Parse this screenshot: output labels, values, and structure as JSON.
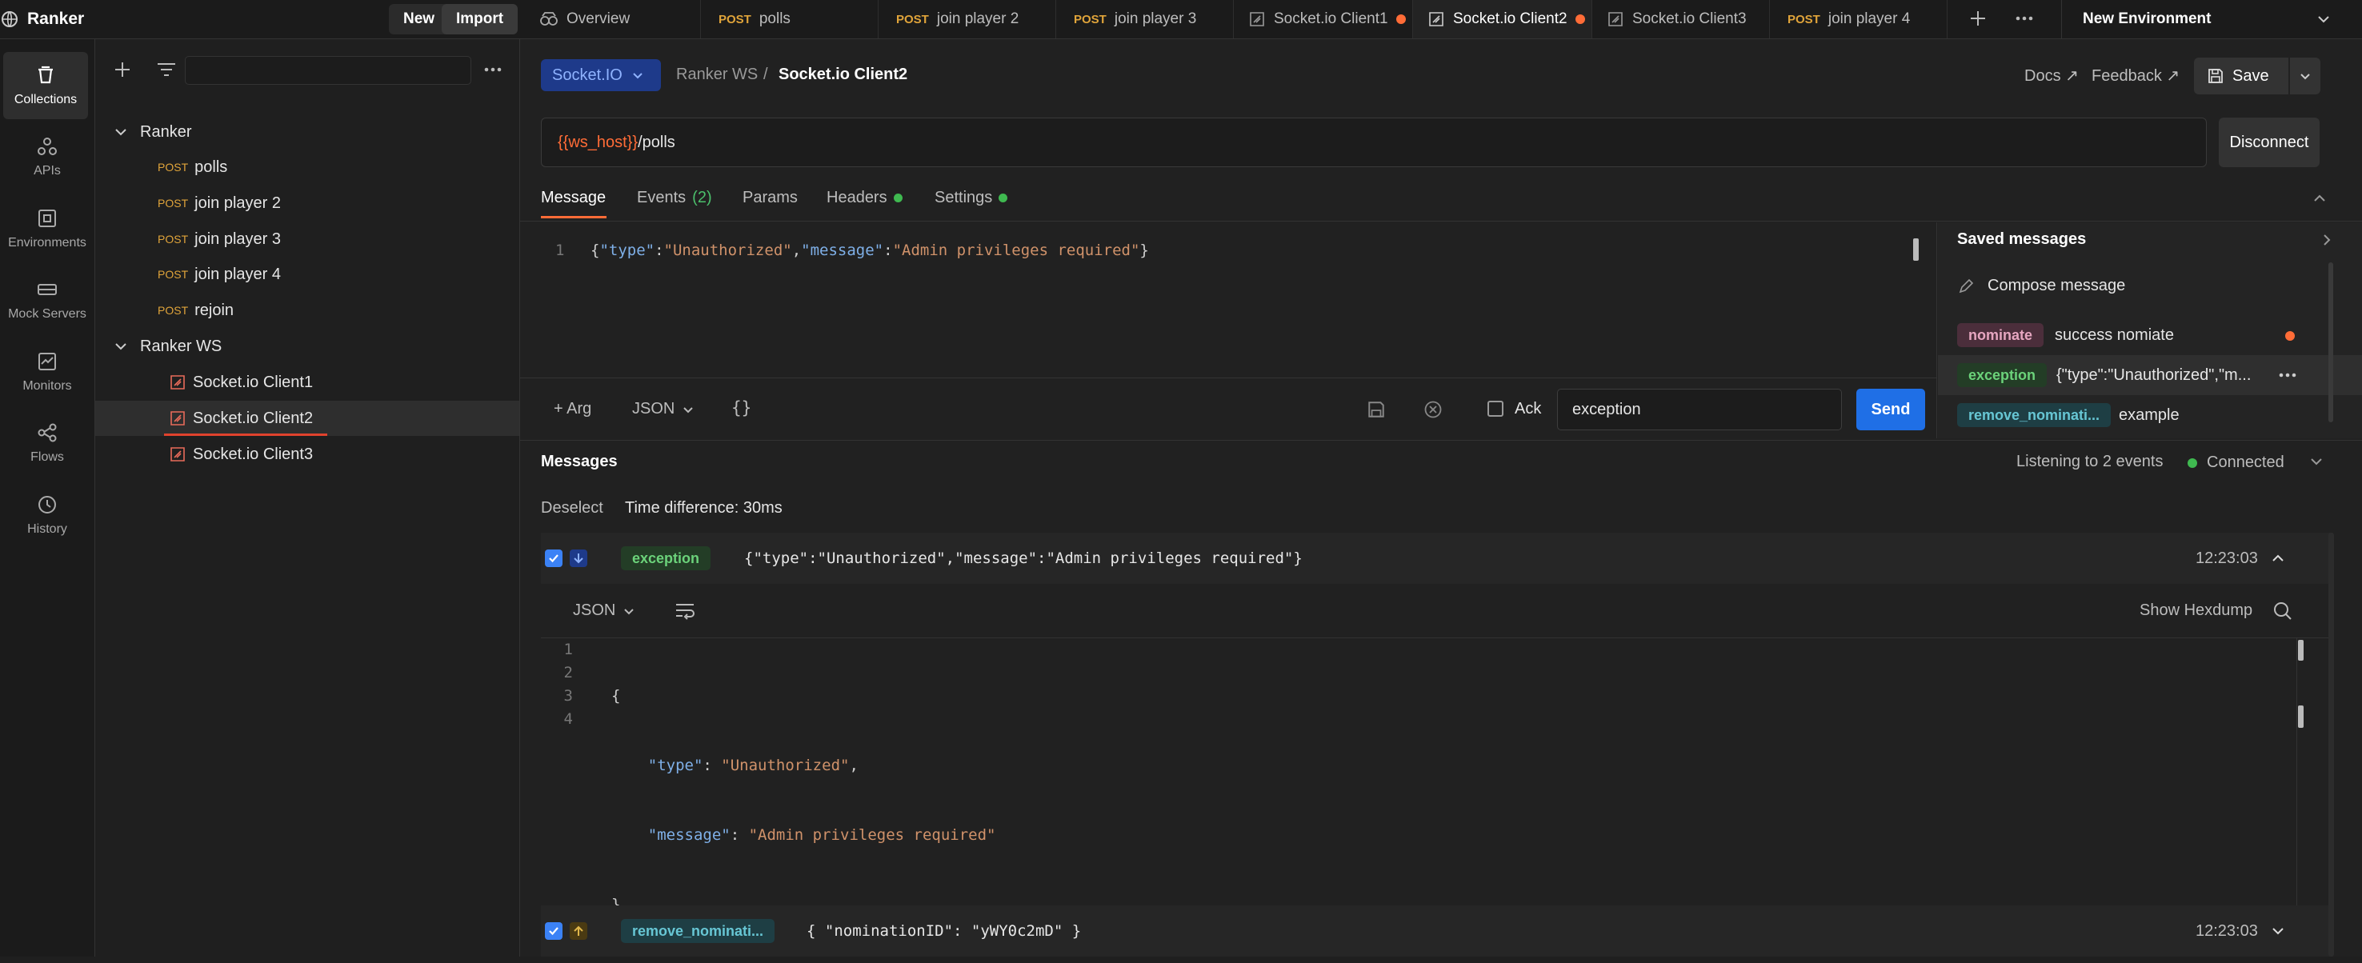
{
  "workspace": {
    "name": "Ranker",
    "new_label": "New",
    "import_label": "Import"
  },
  "tabs": [
    {
      "method": "",
      "label": "Overview",
      "icon": "overview-icon"
    },
    {
      "method": "POST",
      "label": "polls"
    },
    {
      "method": "POST",
      "label": "join player 2"
    },
    {
      "method": "POST",
      "label": "join player 3"
    },
    {
      "method": "",
      "label": "Socket.io Client1",
      "icon": "socketio-icon",
      "unsaved": true
    },
    {
      "method": "",
      "label": "Socket.io Client2",
      "icon": "socketio-icon",
      "unsaved": true,
      "active": true
    },
    {
      "method": "",
      "label": "Socket.io Client3",
      "icon": "socketio-icon"
    },
    {
      "method": "POST",
      "label": "join player 4"
    }
  ],
  "environment": {
    "label": "New Environment"
  },
  "rail": [
    {
      "label": "Collections",
      "icon": "collections-icon",
      "active": true
    },
    {
      "label": "APIs",
      "icon": "apis-icon"
    },
    {
      "label": "Environments",
      "icon": "environments-icon"
    },
    {
      "label": "Mock Servers",
      "icon": "mock-servers-icon"
    },
    {
      "label": "Monitors",
      "icon": "monitors-icon"
    },
    {
      "label": "Flows",
      "icon": "flows-icon"
    },
    {
      "label": "History",
      "icon": "history-icon"
    }
  ],
  "sidebar": {
    "collections": [
      {
        "name": "Ranker",
        "items": [
          {
            "method": "POST",
            "label": "polls"
          },
          {
            "method": "POST",
            "label": "join player 2"
          },
          {
            "method": "POST",
            "label": "join player 3"
          },
          {
            "method": "POST",
            "label": "join player 4"
          },
          {
            "method": "POST",
            "label": "rejoin"
          }
        ]
      },
      {
        "name": "Ranker WS",
        "items": [
          {
            "label": "Socket.io Client1"
          },
          {
            "label": "Socket.io Client2",
            "selected": true
          },
          {
            "label": "Socket.io Client3"
          }
        ]
      }
    ]
  },
  "request": {
    "protocol": "Socket.IO",
    "breadcrumb_parent": "Ranker WS",
    "breadcrumb_sep": "/",
    "title": "Socket.io Client2",
    "docs_label": "Docs ↗",
    "feedback_label": "Feedback ↗",
    "save_label": "Save",
    "url_var": "{{ws_host}}",
    "url_path": "/polls",
    "disconnect_label": "Disconnect"
  },
  "subtabs": {
    "message": "Message",
    "events": "Events",
    "events_count": "(2)",
    "params": "Params",
    "headers": "Headers",
    "settings": "Settings"
  },
  "editor": {
    "line_no": "1",
    "tokens": [
      "{",
      "\"type\"",
      ":",
      "\"Unauthorized\"",
      ",",
      "\"message\"",
      ":",
      "\"Admin privileges required\"",
      "}"
    ]
  },
  "composer": {
    "arg_label": "+ Arg",
    "format": "JSON",
    "ack_label": "Ack",
    "event_value": "exception",
    "send_label": "Send"
  },
  "saved": {
    "title": "Saved messages",
    "compose_label": "Compose message",
    "items": [
      {
        "tag": "nominate",
        "text": "success nomiate",
        "style": "pink",
        "unsaved": true
      },
      {
        "tag": "exception",
        "text": "{\"type\":\"Unauthorized\",\"m...",
        "style": "green",
        "hover": true
      },
      {
        "tag": "remove_nominati...",
        "text": "example",
        "style": "teal"
      }
    ]
  },
  "messages": {
    "title": "Messages",
    "listening": "Listening to 2 events",
    "status": "Connected",
    "deselect": "Deselect",
    "time_diff": "Time difference: 30ms",
    "list": [
      {
        "tag": "exception",
        "direction": "incoming",
        "body": "{\"type\":\"Unauthorized\",\"message\":\"Admin privileges required\"}",
        "time": "12:23:03",
        "expanded": true
      },
      {
        "tag": "remove_nominati...",
        "direction": "outgoing",
        "body": "{ \"nominationID\": \"yWY0c2mD\" }",
        "time": "12:23:03",
        "expanded": false
      }
    ],
    "detail": {
      "format": "JSON",
      "hexdump_label": "Show Hexdump",
      "lines": [
        "1",
        "2",
        "3",
        "4"
      ],
      "l1": "{",
      "l2_key": "\"type\"",
      "l2_val": "\"Unauthorized\"",
      "l3_key": "\"message\"",
      "l3_val": "\"Admin privileges required\"",
      "l4": "}"
    }
  },
  "colors": {
    "accent": "#ff6c37",
    "send": "#1f6fe6",
    "method_post": "#e0a43a",
    "connected": "#3fb950"
  }
}
